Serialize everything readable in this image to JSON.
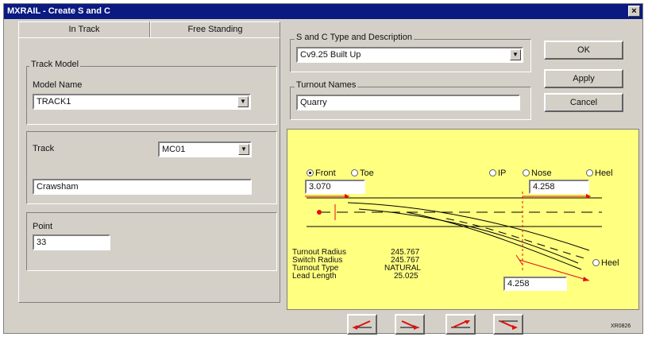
{
  "window": {
    "title": "MXRAIL - Create S and C",
    "close": "×"
  },
  "tabs": [
    {
      "label": "In Track"
    },
    {
      "label": "Free Standing"
    }
  ],
  "track_model": {
    "legend": "Track Model",
    "model_name_label": "Model Name",
    "model_name_value": "TRACK1"
  },
  "track": {
    "label": "Track",
    "code_value": "MC01",
    "name_value": "Crawsham"
  },
  "point": {
    "label": "Point",
    "value": "33"
  },
  "sc_type": {
    "legend": "S and C Type and Description",
    "value": "Cv9.25 Built Up"
  },
  "turnout_names": {
    "legend": "Turnout Names",
    "value": "Quarry"
  },
  "buttons": {
    "ok": "OK",
    "apply": "Apply",
    "cancel": "Cancel"
  },
  "diagram": {
    "radio_front": "Front",
    "radio_toe": "Toe",
    "radio_ip": "IP",
    "radio_nose": "Nose",
    "radio_heel_top": "Heel",
    "radio_heel_side": "Heel",
    "left_value": "3.070",
    "right_value": "4.258",
    "bottom_value": "4.258",
    "info": [
      {
        "label": "Turnout Radius",
        "value": "245.767"
      },
      {
        "label": "Switch Radius",
        "value": "245.767"
      },
      {
        "label": "Turnout Type",
        "value": "NATURAL"
      },
      {
        "label": "Lead Length",
        "value": "25.025"
      }
    ]
  },
  "footer_code": "XR0826",
  "colors": {
    "title_bar": "#0a1a80",
    "diagram_bg": "#ffff80",
    "track_red": "#e01010"
  },
  "icons": [
    "turnout-left-icon",
    "turnout-right-icon",
    "turnout-up-right-icon",
    "turnout-down-right-icon"
  ]
}
